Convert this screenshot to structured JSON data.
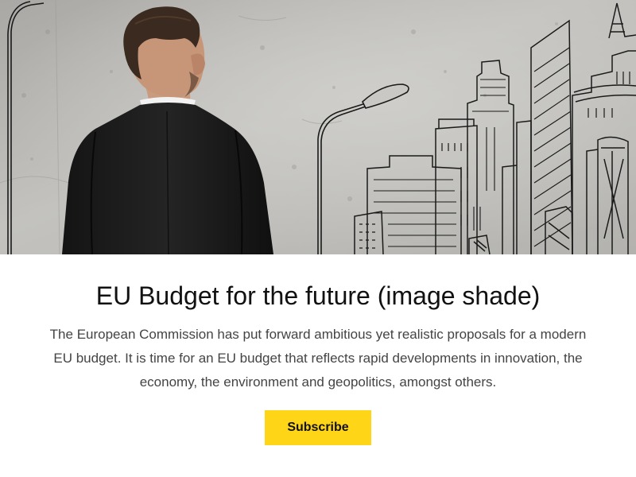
{
  "hero": {
    "image": "man-facing-concrete-wall-with-city-sketch",
    "accent_color": "#ffd617"
  },
  "title": "EU Budget for the future (image shade)",
  "body": "The European Commission has put forward ambitious yet realistic proposals for a modern EU budget. It is time for an EU budget that reflects rapid developments in innovation, the economy, the environment and geopolitics, amongst others.",
  "cta": {
    "label": "Subscribe"
  }
}
